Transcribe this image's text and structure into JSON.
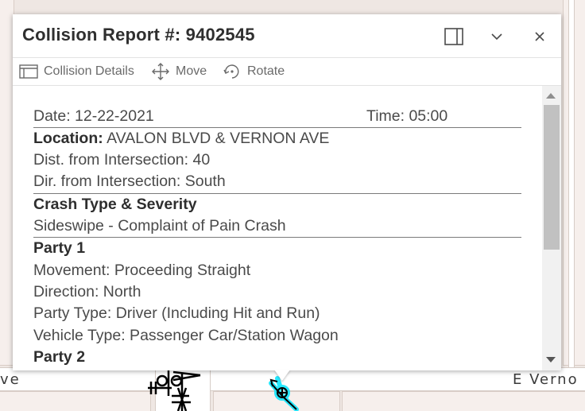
{
  "popup": {
    "title": "Collision Report #: 9402545",
    "dock_icon": "dock-side-icon",
    "collapse_icon": "chevron-down-icon",
    "close_icon": "close-icon"
  },
  "toolbar": {
    "details_label": "Collision Details",
    "move_label": "Move",
    "rotate_label": "Rotate"
  },
  "report": {
    "date": "Date: 12-22-2021",
    "time": "Time: 05:00",
    "location_label": "Location:",
    "location_value": " AVALON BLVD & VERNON AVE",
    "distance": "Dist. from Intersection: 40",
    "direction_from": "Dir. from Intersection: South",
    "crash_heading": "Crash Type & Severity",
    "crash_value": "Sideswipe - Complaint of Pain Crash",
    "party1_heading": "Party 1",
    "party1_movement": "Movement: Proceeding Straight",
    "party1_direction": "Direction: North",
    "party1_type": "Party Type: Driver (Including Hit and Run)",
    "party1_vehicle": "Vehicle Type: Passenger Car/Station Wagon",
    "party2_heading": "Party 2"
  },
  "map": {
    "street_left": "ve",
    "street_right": "E Verno"
  },
  "colors": {
    "highlight": "#00e5ff",
    "symbol": "#000000"
  }
}
